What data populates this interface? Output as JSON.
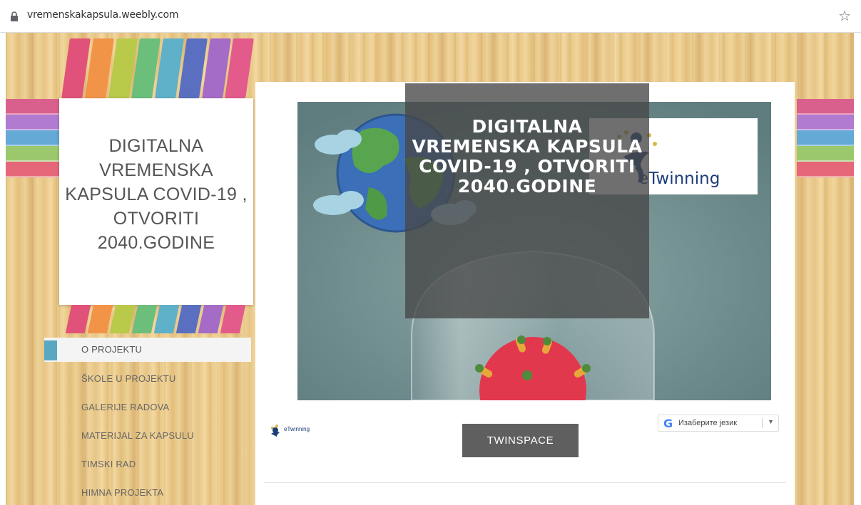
{
  "browser": {
    "url": "vremenskakapsula.weebly.com",
    "lock_icon": "lock-icon",
    "star_icon": "star-icon"
  },
  "site": {
    "title": "DIGITALNA VREMENSKA KAPSULA COVID-19 , OTVORITI 2040.GODINE"
  },
  "nav": {
    "items": [
      {
        "label": "O PROJEKTU",
        "active": true
      },
      {
        "label": "ŠKOLE U PROJEKTU",
        "active": false
      },
      {
        "label": "GALERIJE RADOVA",
        "active": false
      },
      {
        "label": "MATERIJAL ZA KAPSULU",
        "active": false
      },
      {
        "label": "TIMSKI RAD",
        "active": false
      },
      {
        "label": "HIMNA PROJEKTA",
        "active": false
      }
    ]
  },
  "banner": {
    "title": "DIGITALNA VREMENSKA KAPSULA COVID-19 , OTVORITI 2040.GODINE",
    "logo_text": "eTwinning"
  },
  "footer_area": {
    "small_logo_text": "eTwinning",
    "twinspace_label": "TWINSPACE",
    "language_select": "Изаберите језик"
  },
  "colors": {
    "accent_blue": "#5aa7c1",
    "ribbons": [
      "#e0527a",
      "#f29448",
      "#b9c94a",
      "#6cbf7a",
      "#5fb0c9",
      "#5a6fc0",
      "#a46cc6",
      "#e25b8b"
    ],
    "stripes": [
      "#d95f8c",
      "#b07bd0",
      "#65a9d6",
      "#9bc86c",
      "#e6677a"
    ]
  }
}
